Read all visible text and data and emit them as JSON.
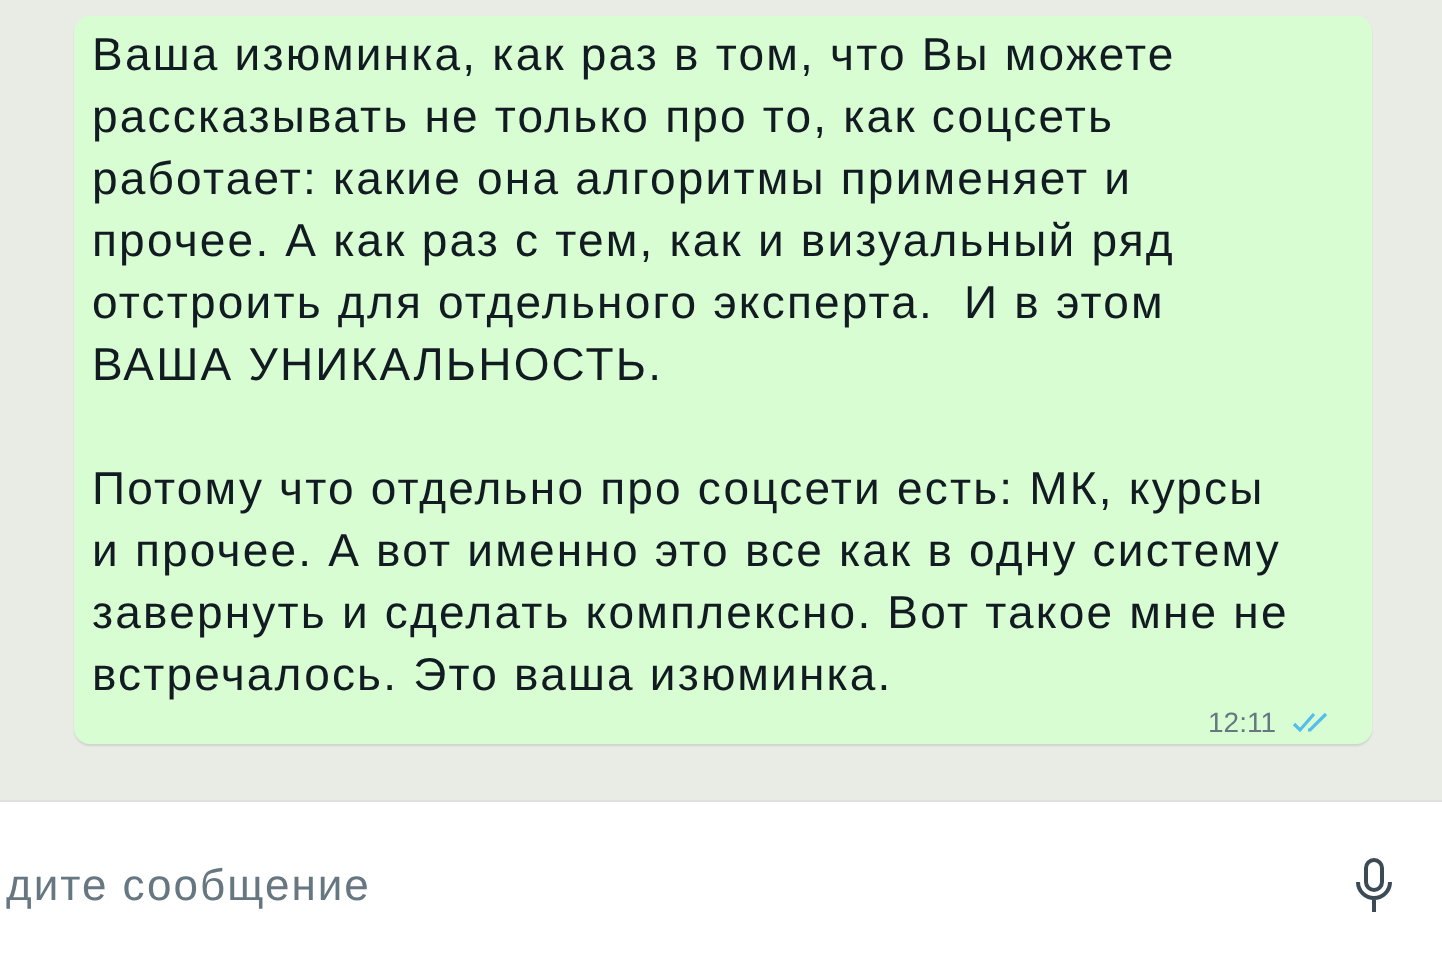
{
  "message": {
    "paragraphs": [
      "Ваша изюминка, как раз в том, что Вы можете рассказывать не только про то, как соцсеть работает: какие она алгоритмы применяет и прочее. А как раз с тем, как и визуальный ряд отстроить для отдельного эксперта.  И в этом ВАША УНИКАЛЬНОСТЬ.",
      "Потому что отдельно про соцсети есть: МК, курсы и прочее. А вот именно это все как в одну систему завернуть и сделать комплексно. Вот такое мне не встречалось. Это ваша изюминка."
    ],
    "time": "12:11",
    "read": true
  },
  "composer": {
    "placeholder": "дите сообщение"
  }
}
